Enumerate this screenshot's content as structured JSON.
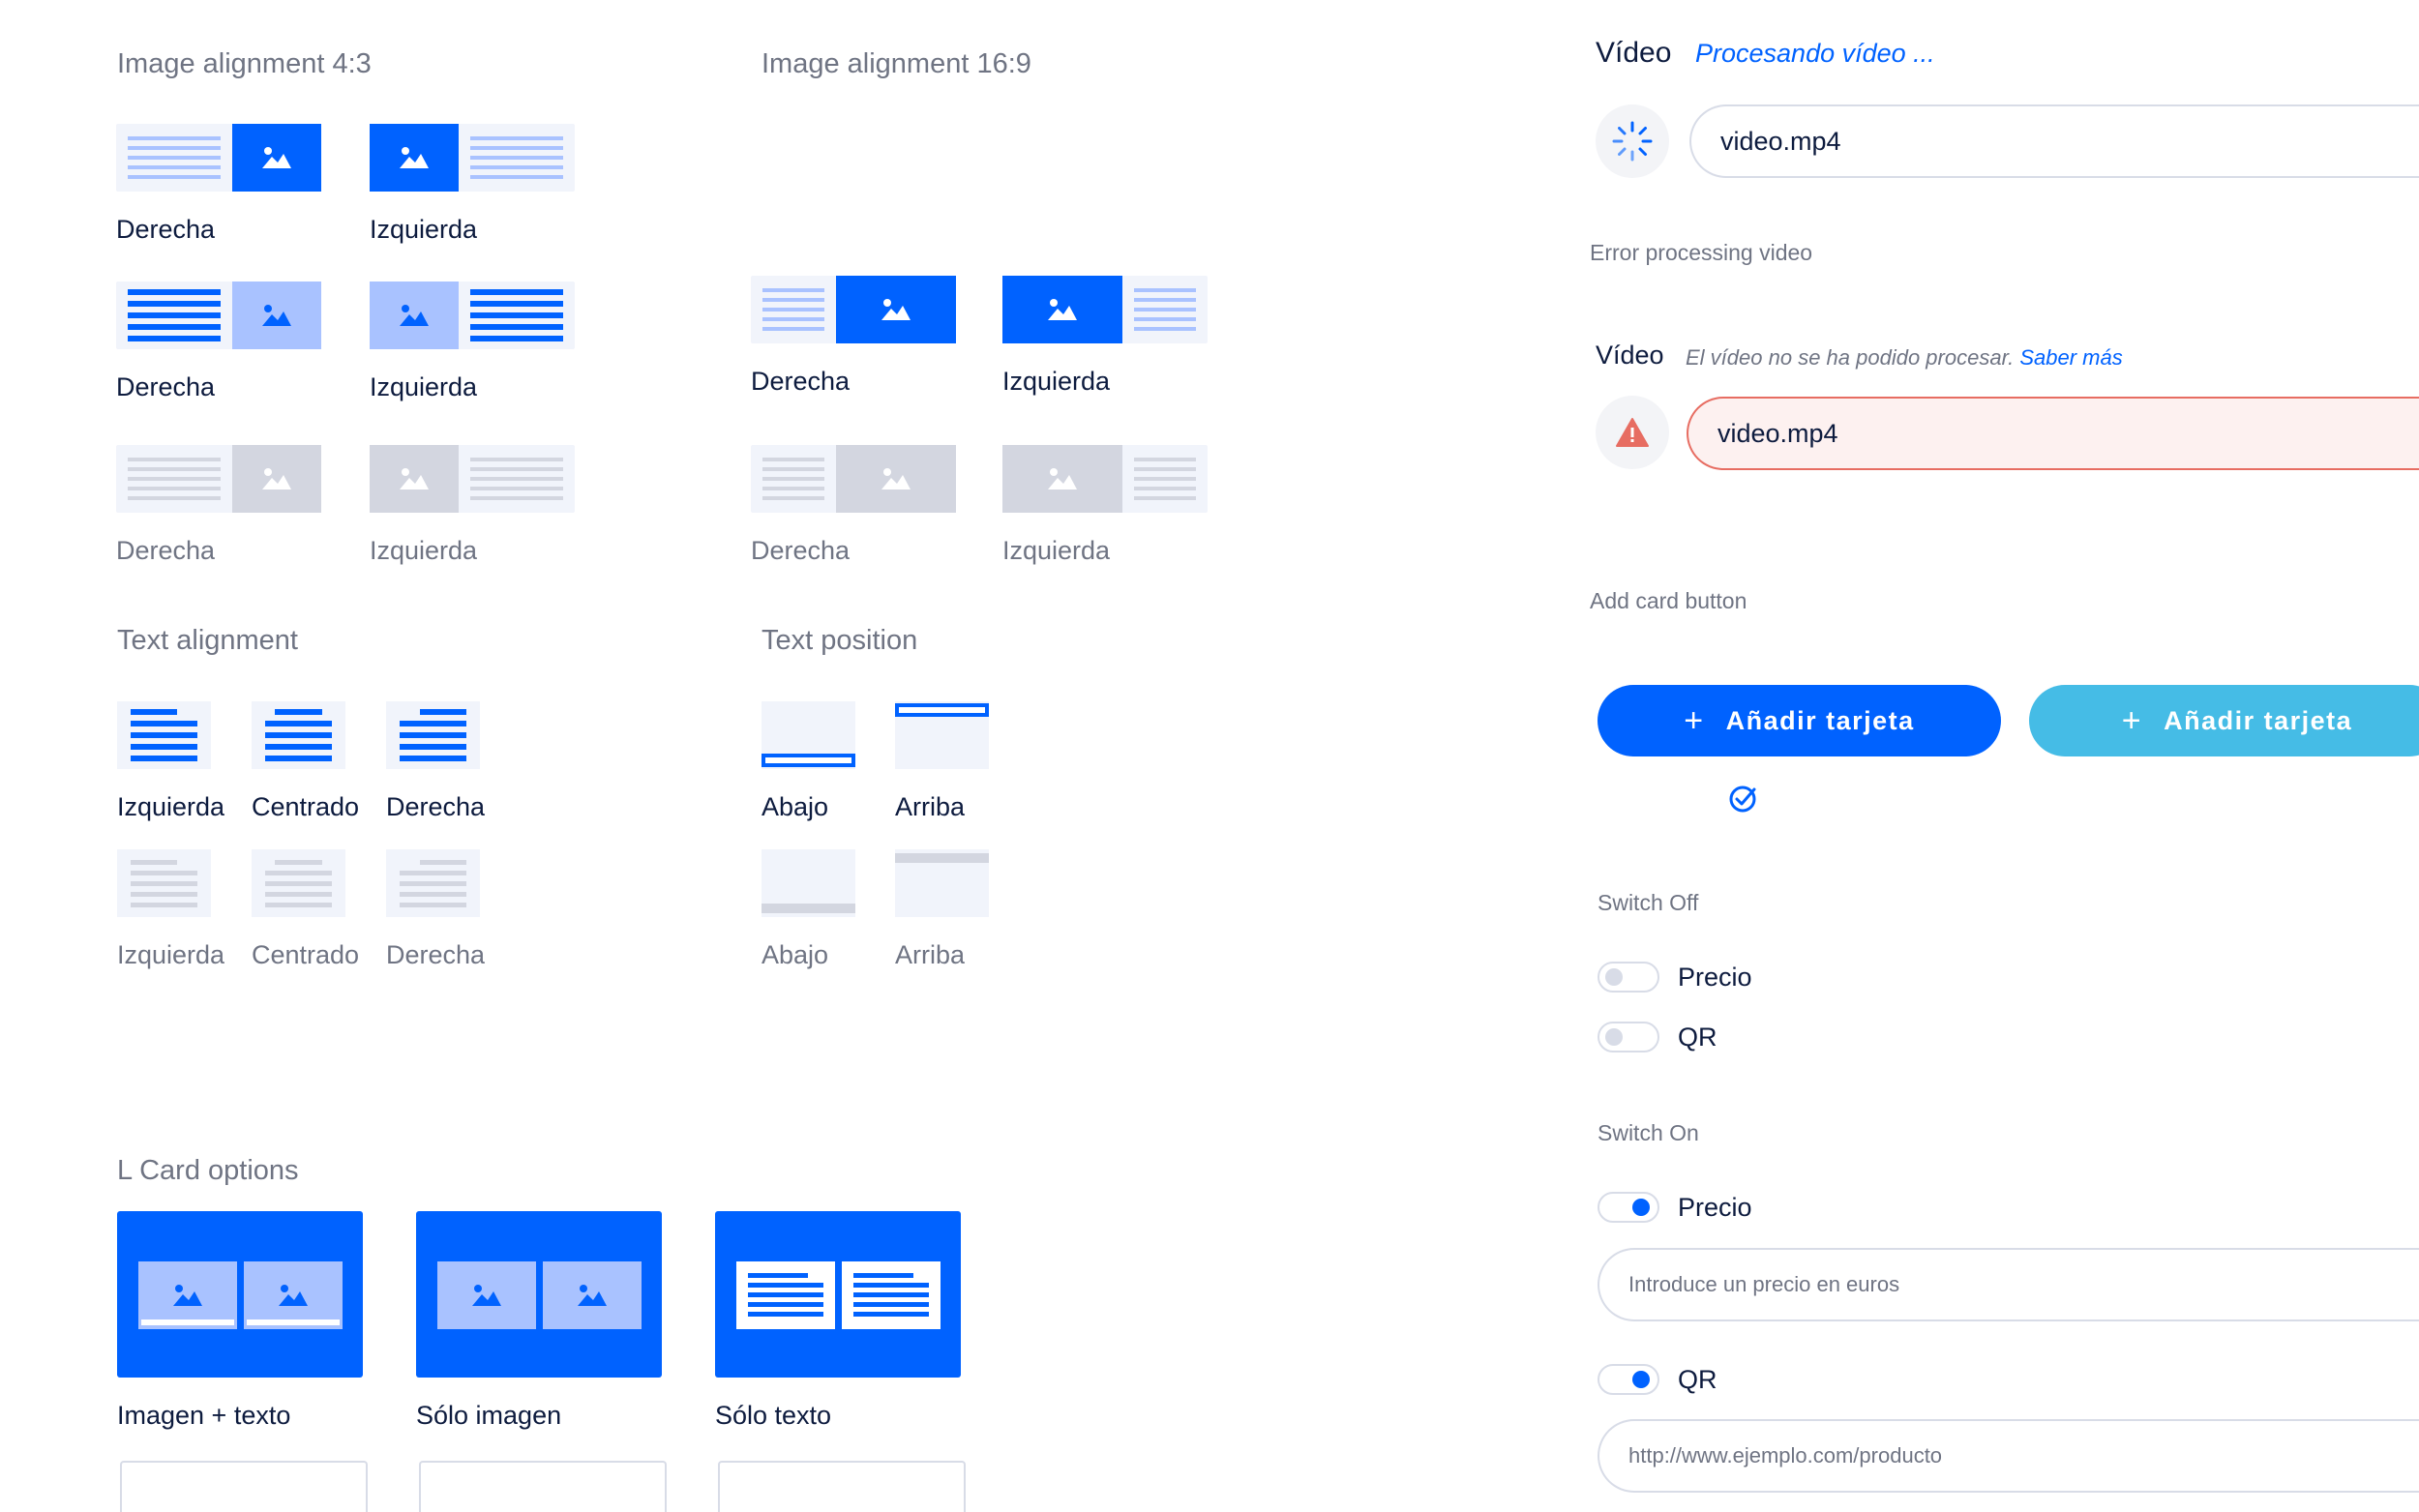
{
  "image_alignment_43": {
    "title": "Image alignment 4:3",
    "rows": [
      {
        "state": "selected",
        "labels": [
          "Derecha",
          "Izquierda"
        ]
      },
      {
        "state": "hover",
        "labels": [
          "Derecha",
          "Izquierda"
        ]
      },
      {
        "state": "disabled",
        "labels": [
          "Derecha",
          "Izquierda"
        ]
      }
    ]
  },
  "image_alignment_169": {
    "title": "Image alignment 16:9",
    "rows": [
      {
        "state": "selected",
        "labels": [
          "Derecha",
          "Izquierda"
        ]
      },
      {
        "state": "disabled",
        "labels": [
          "Derecha",
          "Izquierda"
        ]
      }
    ]
  },
  "text_alignment": {
    "title": "Text alignment",
    "labels": [
      "Izquierda",
      "Centrado",
      "Derecha"
    ],
    "disabled_labels": [
      "Izquierda",
      "Centrado",
      "Derecha"
    ]
  },
  "text_position": {
    "title": "Text position",
    "labels": [
      "Abajo",
      "Arriba"
    ],
    "disabled_labels": [
      "Abajo",
      "Arriba"
    ]
  },
  "l_card_options": {
    "title": "L Card options",
    "cards": [
      "Imagen + texto",
      "Sólo imagen",
      "Sólo texto"
    ]
  },
  "video_processing": {
    "label": "Vídeo",
    "status": "Procesando vídeo ...",
    "file": "video.mp4",
    "spinner_icon": "spinner-icon"
  },
  "video_error": {
    "section_title": "Error processing video",
    "label": "Vídeo",
    "message": "El vídeo no se ha podido procesar.",
    "link": "Saber más",
    "file": "video.mp4",
    "warning_icon": "warning-icon"
  },
  "add_card": {
    "section_title": "Add card button",
    "primary_label": "Añadir tarjeta",
    "secondary_label": "Añadir tarjeta",
    "primary_color": "#0062ff",
    "secondary_color": "#45bce6"
  },
  "switch_off": {
    "section_title": "Switch Off",
    "items": [
      "Precio",
      "QR"
    ]
  },
  "switch_on": {
    "section_title": "Switch On",
    "price_label": "Precio",
    "price_placeholder": "Introduce un precio en euros",
    "qr_label": "QR",
    "qr_placeholder": "http://www.ejemplo.com/producto"
  },
  "colors": {
    "accent": "#0062ff",
    "accent_light": "#a9c2ff",
    "disabled": "#d3d6e0",
    "panel_bg": "#f1f4fb",
    "error": "#e76d62"
  }
}
